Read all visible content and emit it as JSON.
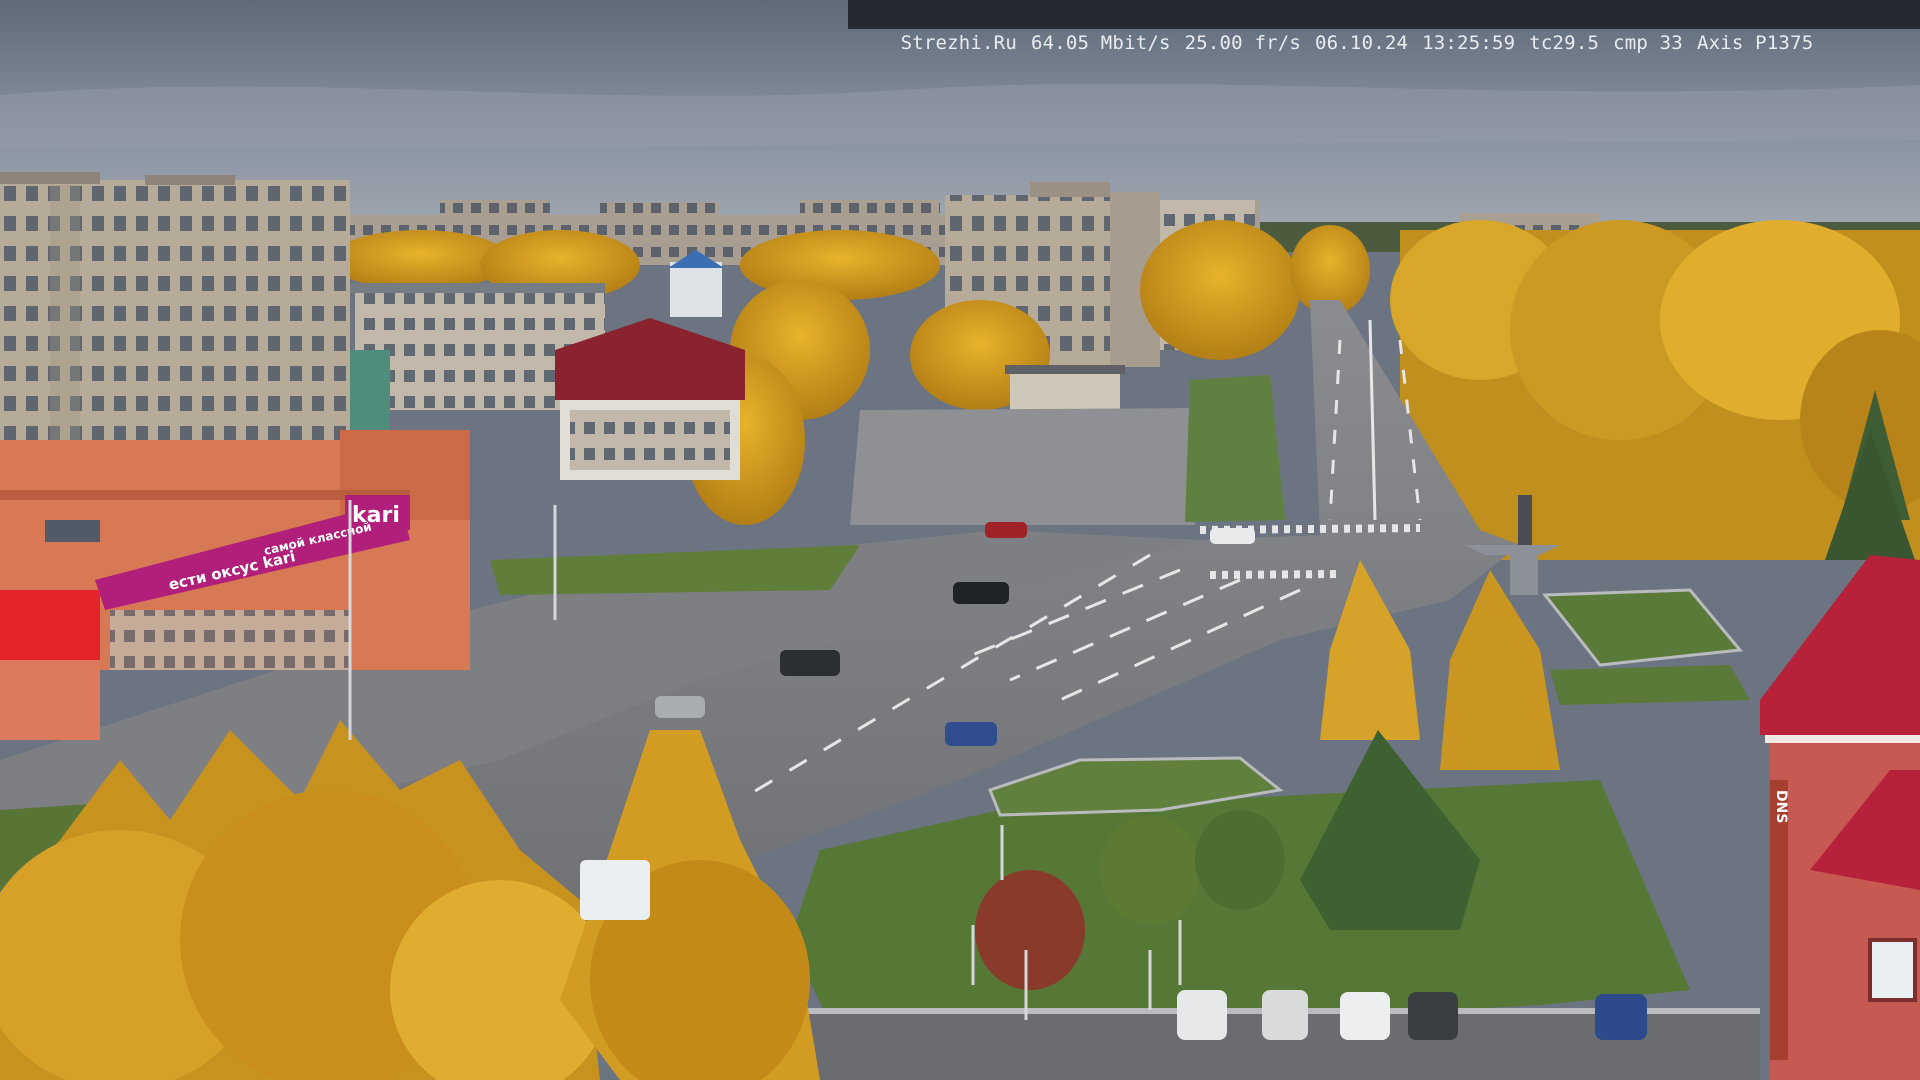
{
  "camera_overlay": {
    "site": "Strezhi.Ru",
    "bitrate": "64.05 Mbit/s",
    "framerate": "25.00 fr/s",
    "date": "06.10.24",
    "time": "13:25:59",
    "tc": "tc29.5",
    "cmp": "cmp 33",
    "camera_model": "Axis P1375"
  },
  "signage": {
    "store_brand": "kari",
    "store_banner_left": "ести оксус kari",
    "store_banner_right": "самой классной",
    "hotel_sign": "DNS"
  },
  "colors": {
    "sky": "#7d8794",
    "autumn_foliage": "#d9a21e",
    "asphalt": "#7a7c80",
    "grass": "#5d7d3c",
    "store_magenta": "#b0207a"
  }
}
